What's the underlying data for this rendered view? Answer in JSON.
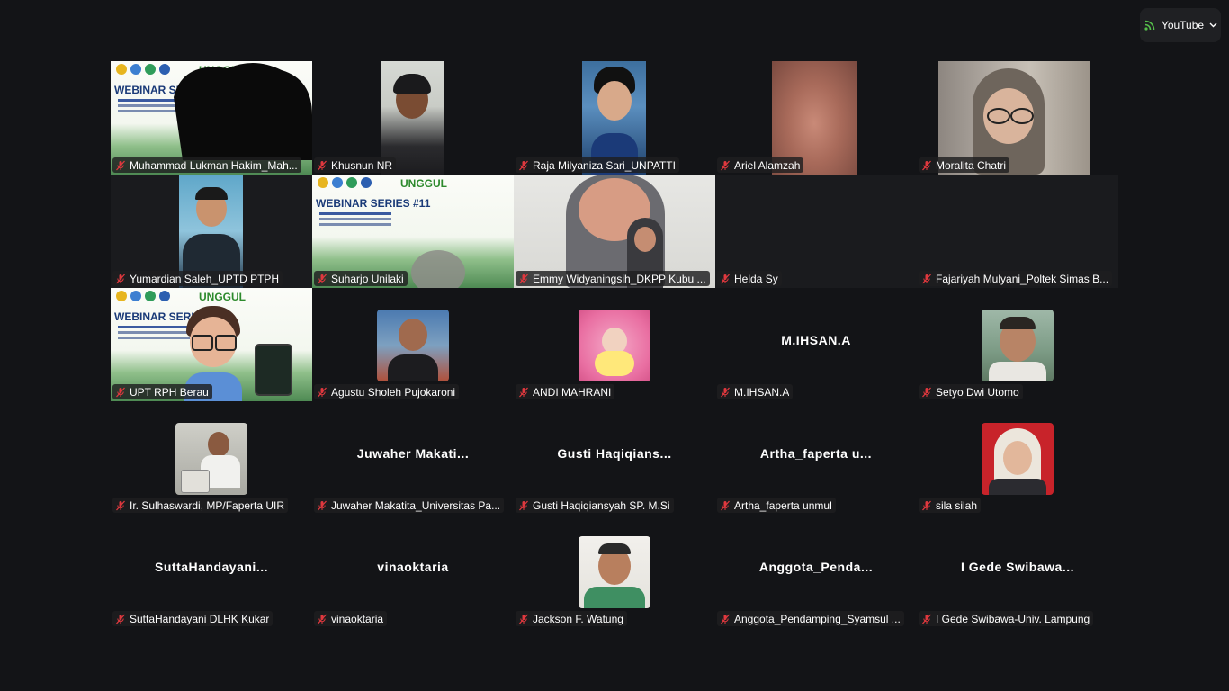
{
  "top_right": {
    "label": "YouTube"
  },
  "colors": {
    "background": "#131417",
    "muted_red": "#e0383e",
    "live_green": "#55c04a"
  },
  "slide": {
    "title": "WEBINAR SERIES",
    "title_numbered": "WEBINAR SERIES #11",
    "brand": "UNGGUL"
  },
  "participants": [
    {
      "name": "Muhammad Lukman Hakim_Mah...",
      "type": "video"
    },
    {
      "name": "Khusnun NR",
      "type": "video"
    },
    {
      "name": "Raja Milyaniza Sari_UNPATTI",
      "type": "video"
    },
    {
      "name": "Ariel Alamzah",
      "type": "video"
    },
    {
      "name": "Moralita Chatri",
      "type": "video"
    },
    {
      "name": "Yumardian Saleh_UPTD PTPH",
      "type": "video"
    },
    {
      "name": "Suharjo Unilaki",
      "type": "video"
    },
    {
      "name": "Emmy Widyaningsih_DKPP Kubu ...",
      "type": "video"
    },
    {
      "name": "Helda Sy",
      "type": "off"
    },
    {
      "name": "Fajariyah Mulyani_Poltek Simas B...",
      "type": "off"
    },
    {
      "name": "UPT RPH Berau",
      "type": "video"
    },
    {
      "name": "Agustu Sholeh Pujokaroni",
      "type": "avatar"
    },
    {
      "name": "ANDI MAHRANI",
      "type": "avatar"
    },
    {
      "name": "M.IHSAN.A",
      "type": "text",
      "display": "M.IHSAN.A"
    },
    {
      "name": "Setyo Dwi Utomo",
      "type": "avatar"
    },
    {
      "name": "Ir. Sulhaswardi, MP/Faperta UIR",
      "type": "avatar"
    },
    {
      "name": "Juwaher Makatita_Universitas Pa...",
      "type": "text",
      "display": "Juwaher  Makati..."
    },
    {
      "name": "Gusti Haqiqiansyah SP. M.Si",
      "type": "text",
      "display": "Gusti  Haqiqians..."
    },
    {
      "name": "Artha_faperta unmul",
      "type": "text",
      "display": "Artha_faperta  u..."
    },
    {
      "name": "sila silah",
      "type": "avatar"
    },
    {
      "name": "SuttaHandayani DLHK Kukar",
      "type": "text",
      "display": "SuttaHandayani..."
    },
    {
      "name": "vinaoktaria",
      "type": "text",
      "display": "vinaoktaria"
    },
    {
      "name": "Jackson F. Watung",
      "type": "avatar"
    },
    {
      "name": "Anggota_Pendamping_Syamsul ...",
      "type": "text",
      "display": "Anggota_Penda..."
    },
    {
      "name": "I Gede Swibawa-Univ. Lampung",
      "type": "text",
      "display": "I  Gede  Swibawa..."
    }
  ]
}
